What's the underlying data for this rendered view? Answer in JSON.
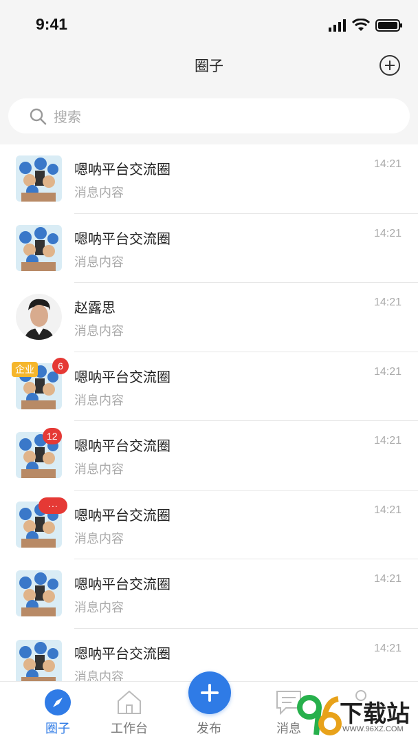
{
  "status_bar": {
    "time": "9:41"
  },
  "nav": {
    "title": "圈子"
  },
  "search": {
    "placeholder": "搜索"
  },
  "items": [
    {
      "title": "嗯呐平台交流圈",
      "subtitle": "消息内容",
      "time": "14:21"
    },
    {
      "title": "嗯呐平台交流圈",
      "subtitle": "消息内容",
      "time": "14:21"
    },
    {
      "title": "赵露思",
      "subtitle": "消息内容",
      "time": "14:21"
    },
    {
      "title": "嗯呐平台交流圈",
      "subtitle": "消息内容",
      "time": "14:21",
      "tag": "企业",
      "badge": "6"
    },
    {
      "title": "嗯呐平台交流圈",
      "subtitle": "消息内容",
      "time": "14:21",
      "badge": "12"
    },
    {
      "title": "嗯呐平台交流圈",
      "subtitle": "消息内容",
      "time": "14:21",
      "badge": "···"
    },
    {
      "title": "嗯呐平台交流圈",
      "subtitle": "消息内容",
      "time": "14:21"
    },
    {
      "title": "嗯呐平台交流圈",
      "subtitle": "消息内容",
      "time": "14:21"
    }
  ],
  "tabs": [
    {
      "label": "圈子",
      "icon": "compass-icon",
      "active": true
    },
    {
      "label": "工作台",
      "icon": "home-icon"
    },
    {
      "label": "发布",
      "icon": "plus-icon"
    },
    {
      "label": "消息",
      "icon": "chat-icon"
    }
  ],
  "watermark": {
    "brand": "96",
    "text": "下载站",
    "url": "WWW.96XZ.COM"
  },
  "colors": {
    "accent": "#2f7be6",
    "badge": "#e53935",
    "corp_tag": "#f5b62c"
  }
}
